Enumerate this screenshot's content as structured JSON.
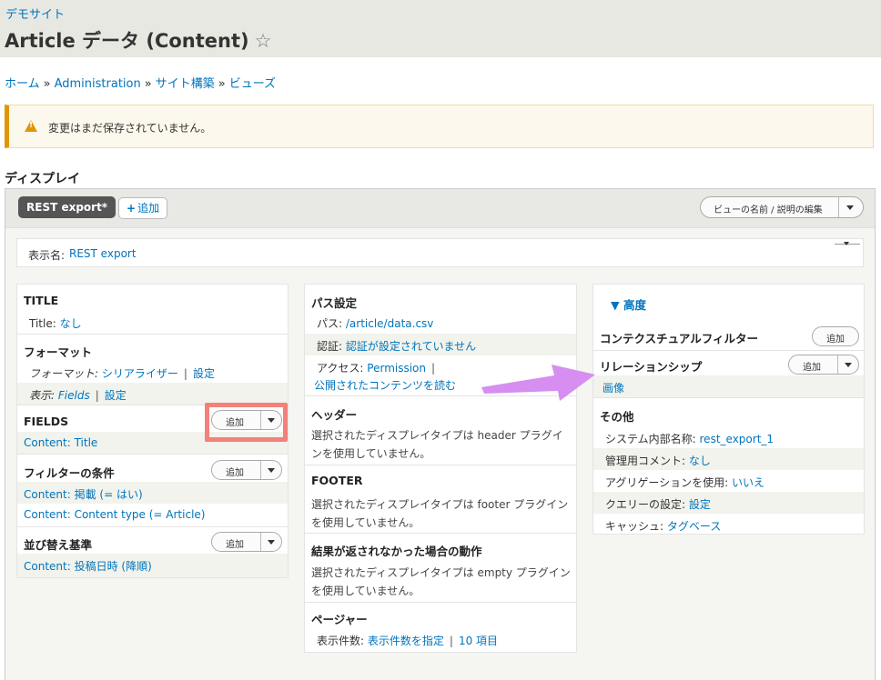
{
  "header": {
    "site_name": "デモサイト",
    "title": "Article データ (Content)",
    "star_icon": "☆"
  },
  "breadcrumb": [
    "ホーム",
    "Administration",
    "サイト構築",
    "ビューズ"
  ],
  "breadcrumb_sep": "»",
  "warning": {
    "text": "変更はまだ保存されていません。"
  },
  "section_label": "ディスプレイ",
  "tabs": {
    "active": "REST export*",
    "add": "追加",
    "add_icon": "+"
  },
  "edit_dropdown": {
    "label": "ビューの名前 / 説明の編集"
  },
  "display_name": {
    "label": "表示名:",
    "value": "REST export"
  },
  "left": {
    "title": {
      "heading": "TITLE",
      "label": "Title:",
      "value": "なし"
    },
    "format": {
      "heading": "フォーマット",
      "format_label": "フォーマット:",
      "format_value": "シリアライザー",
      "format_setting": "設定",
      "show_label": "表示:",
      "show_value": "Fields",
      "show_setting": "設定"
    },
    "fields": {
      "heading": "FIELDS",
      "button": "追加",
      "items": [
        "Content: Title"
      ]
    },
    "filters": {
      "heading": "フィルターの条件",
      "button": "追加",
      "items": [
        "Content: 掲載 (= はい)",
        "Content: Content type (= Article)"
      ]
    },
    "sort": {
      "heading": "並び替え基準",
      "button": "追加",
      "items": [
        "Content: 投稿日時 (降順)"
      ]
    }
  },
  "middle": {
    "path": {
      "heading": "パス設定",
      "path_label": "パス:",
      "path_value": "/article/data.csv",
      "auth_label": "認証:",
      "auth_value": "認証が設定されていません",
      "access_label": "アクセス:",
      "access_value": "Permission",
      "access_value2": "公開されたコンテンツを読む"
    },
    "header": {
      "heading": "ヘッダー",
      "text1": "選択されたディスプレイタイプは header プラグイ",
      "text2": "ンを使用していません。"
    },
    "footer": {
      "heading": "FOOTER",
      "text1": "選択されたディスプレイタイプは footer プラグイン",
      "text2": "を使用していません。"
    },
    "empty": {
      "heading": "結果が返されなかった場合の動作",
      "text1": "選択されたディスプレイタイプは empty プラグイン",
      "text2": "を使用していません。"
    },
    "pager": {
      "heading": "ページャー",
      "label": "表示件数:",
      "value": "表示件数を指定",
      "value2": "10 項目"
    }
  },
  "right": {
    "advanced": "▼ 高度",
    "contextual": {
      "heading": "コンテクスチュアルフィルター",
      "button": "追加"
    },
    "relationships": {
      "heading": "リレーションシップ",
      "button": "追加",
      "items": [
        "画像"
      ]
    },
    "other": {
      "heading": "その他",
      "machine_label": "システム内部名称:",
      "machine_value": "rest_export_1",
      "comment_label": "管理用コメント:",
      "comment_value": "なし",
      "agg_label": "アグリゲーションを使用:",
      "agg_value": "いいえ",
      "query_label": "クエリーの設定:",
      "query_value": "設定",
      "cache_label": "キャッシュ:",
      "cache_value": "タグベース"
    }
  },
  "colors": {
    "accent": "#0074bd",
    "warning": "#e09600",
    "highlight": "#f3807a",
    "arrow": "#d68ef0"
  }
}
